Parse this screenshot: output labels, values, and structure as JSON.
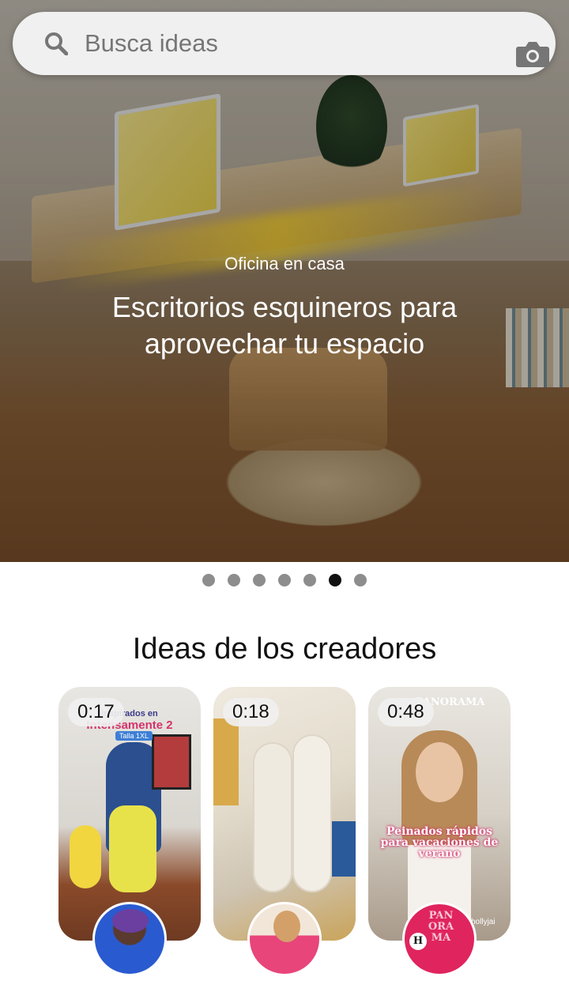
{
  "search": {
    "placeholder": "Busca ideas",
    "icons": {
      "left": "search-icon",
      "right": "camera-icon"
    }
  },
  "hero": {
    "subtitle": "Oficina en casa",
    "title": "Escritorios esquineros para aprovechar tu espacio",
    "carousel": {
      "total": 7,
      "active_index": 5
    }
  },
  "section": {
    "title": "Ideas de los creadores"
  },
  "cards": [
    {
      "duration": "0:17",
      "overlay_line1": "inspirados en",
      "overlay_line2": "Intensamente 2",
      "overlay_tag": "Talla 1XL",
      "creator_avatar": "creator-avatar-1"
    },
    {
      "duration": "0:18",
      "creator_avatar": "creator-avatar-2"
    },
    {
      "duration": "0:48",
      "watermark": "PANORAMA",
      "overlay_text": "Peinados rápidos para vacaciones de verano",
      "handle": "hollyjai",
      "avatar_text": "PANORAMA",
      "avatar_badge": "H"
    }
  ],
  "colors": {
    "accent_pink": "#e0245e",
    "dot_active": "#111111",
    "dot_inactive": "#8d8d8d"
  }
}
